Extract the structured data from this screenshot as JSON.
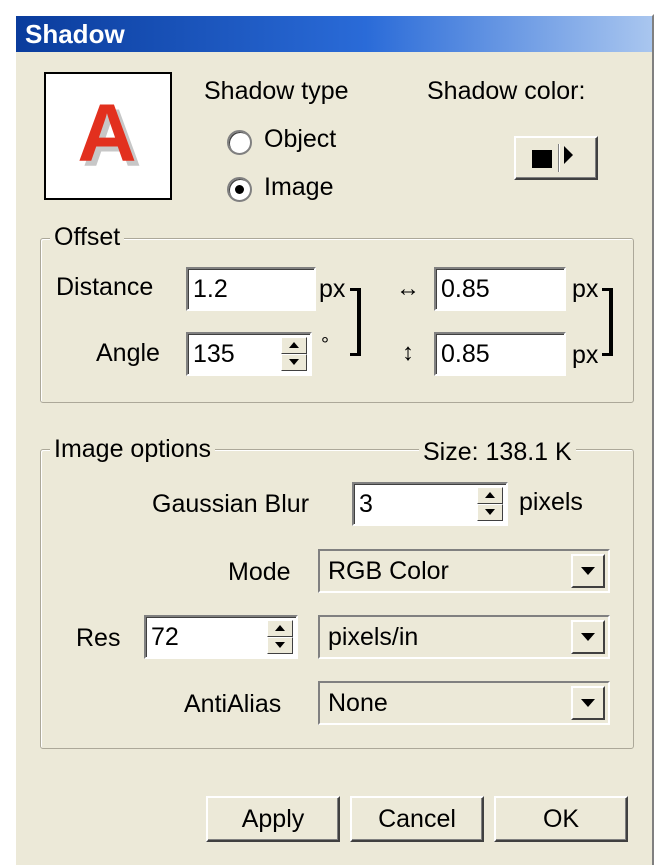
{
  "dialog": {
    "title": "Shadow"
  },
  "preview": {
    "letter": "A",
    "letter_color": "#e2301e"
  },
  "shadow_type": {
    "label": "Shadow type",
    "options": [
      {
        "label": "Object",
        "selected": false
      },
      {
        "label": "Image",
        "selected": true
      }
    ]
  },
  "shadow_color": {
    "label": "Shadow color:",
    "value": "#000000"
  },
  "offset": {
    "legend": "Offset",
    "distance": {
      "label": "Distance",
      "value": "1.2",
      "unit": "px"
    },
    "angle": {
      "label": "Angle",
      "value": "135",
      "unit": "°"
    },
    "horizontal": {
      "icon": "horizontal-arrows-icon",
      "value": "0.85",
      "unit": "px"
    },
    "vertical": {
      "icon": "vertical-arrows-icon",
      "value": "0.85",
      "unit": "px"
    }
  },
  "image_options": {
    "legend": "Image options",
    "size": "Size: 138.1 K",
    "gaussian_blur": {
      "label": "Gaussian Blur",
      "value": "3",
      "unit": "pixels"
    },
    "mode": {
      "label": "Mode",
      "value": "RGB Color"
    },
    "res": {
      "label": "Res",
      "value": "72",
      "unit_value": "pixels/in"
    },
    "antialias": {
      "label": "AntiAlias",
      "value": "None"
    }
  },
  "buttons": {
    "apply": "Apply",
    "cancel": "Cancel",
    "ok": "OK"
  }
}
